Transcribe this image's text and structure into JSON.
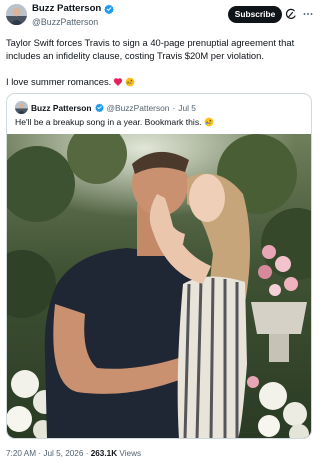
{
  "tweet": {
    "author_name": "Buzz Patterson",
    "author_handle": "@BuzzPatterson",
    "subscribe_label": "Subscribe",
    "text_line1": "Taylor Swift forces Travis to sign a 40-page prenuptial agreement that includes an infidelity clause, costing Travis $20M per violation.",
    "text_line2": "I love summer romances.",
    "text_line2_emojis": [
      "red-heart-emoji",
      "rolling-on-floor-laughing-emoji"
    ],
    "verified_color": "#1d9bf0"
  },
  "quote": {
    "author_name": "Buzz Patterson",
    "author_handle": "@BuzzPatterson",
    "separator": "·",
    "date": "Jul 5",
    "text": "He'll be a breakup song in a year. Bookmark this.",
    "text_emoji": "rolling-on-floor-laughing-emoji",
    "photo": "couple-embracing-in-garden-photo"
  },
  "footer": {
    "time": "7:20 AM",
    "sep1": "·",
    "date": "Jul 5, 2026",
    "sep2": "·",
    "views_count": "263.1K",
    "views_label": "Views"
  }
}
